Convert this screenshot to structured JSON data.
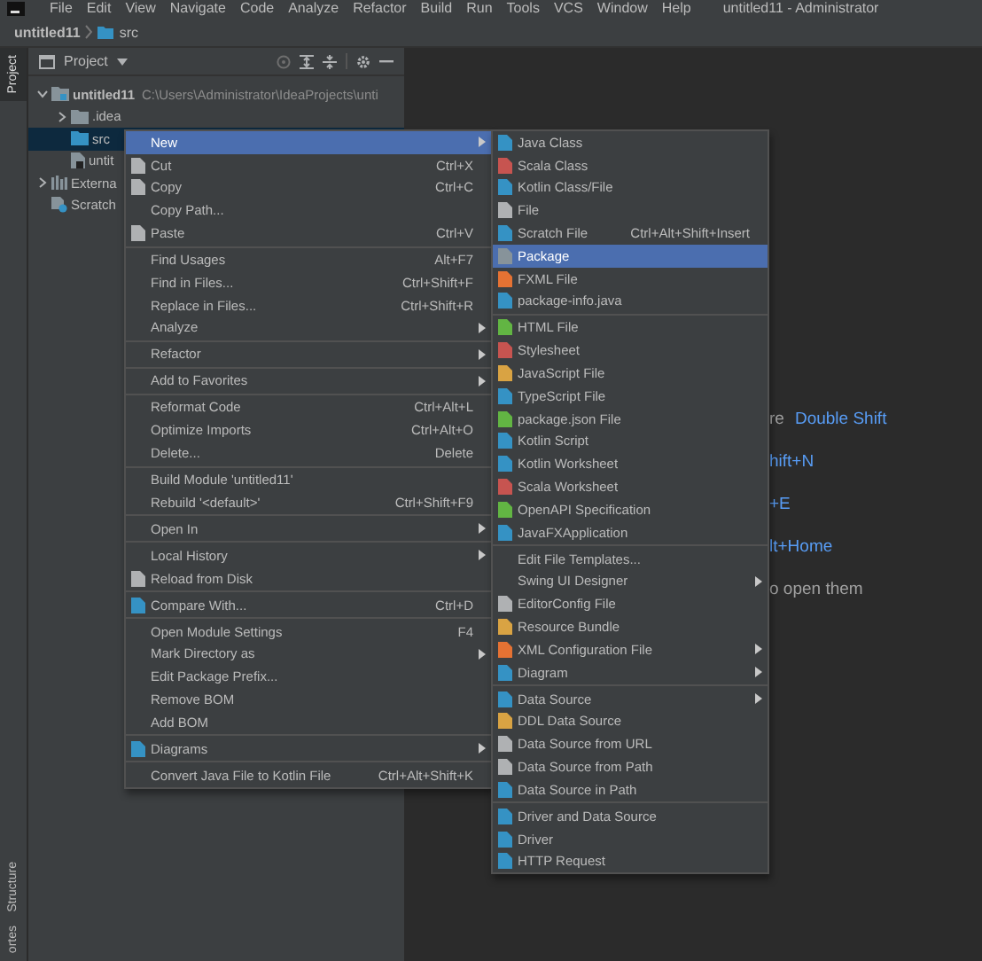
{
  "menubar": {
    "items": [
      "File",
      "Edit",
      "View",
      "Navigate",
      "Code",
      "Analyze",
      "Refactor",
      "Build",
      "Run",
      "Tools",
      "VCS",
      "Window",
      "Help"
    ],
    "title": "untitled11 - Administrator"
  },
  "breadcrumb": [
    "untitled11",
    "src"
  ],
  "tool_strip": [
    {
      "label": "Project",
      "selected": true
    },
    {
      "label": "Structure",
      "selected": false
    },
    {
      "label": "ortes",
      "selected": false
    }
  ],
  "project_panel": {
    "title": "Project",
    "tree": [
      {
        "kind": "module",
        "label": "untitled11",
        "path": "C:\\Users\\Administrator\\IdeaProjects\\unti",
        "expanded": true,
        "selected": false,
        "children": [
          {
            "kind": "folder",
            "label": ".idea",
            "expanded": false,
            "selected": false
          },
          {
            "kind": "source-folder",
            "label": "src",
            "selected": true
          },
          {
            "kind": "file",
            "label": "untit",
            "selected": false
          }
        ]
      },
      {
        "kind": "libraries",
        "label": "Externa",
        "expanded": false,
        "selected": false
      },
      {
        "kind": "scratches",
        "label": "Scratch",
        "selected": false
      }
    ]
  },
  "editor_hints": [
    {
      "text": "re",
      "shortcut": "Double Shift"
    },
    {
      "shortcut": "hift+N"
    },
    {
      "shortcut": "+E"
    },
    {
      "shortcut": "lt+Home"
    },
    {
      "text": "o open them"
    }
  ],
  "context_menu": [
    [
      {
        "label": "New",
        "submenu": true,
        "selected": true
      },
      {
        "label": "Cut",
        "shortcut": "Ctrl+X",
        "color": "#afb1b3",
        "selected": false
      },
      {
        "label": "Copy",
        "shortcut": "Ctrl+C",
        "color": "#afb1b3",
        "selected": false
      },
      {
        "label": "Copy Path...",
        "selected": false
      },
      {
        "label": "Paste",
        "shortcut": "Ctrl+V",
        "color": "#afb1b3",
        "selected": false
      }
    ],
    [
      {
        "label": "Find Usages",
        "shortcut": "Alt+F7",
        "selected": false
      },
      {
        "label": "Find in Files...",
        "shortcut": "Ctrl+Shift+F",
        "selected": false
      },
      {
        "label": "Replace in Files...",
        "shortcut": "Ctrl+Shift+R",
        "selected": false
      },
      {
        "label": "Analyze",
        "submenu": true,
        "selected": false
      }
    ],
    [
      {
        "label": "Refactor",
        "submenu": true,
        "selected": false
      }
    ],
    [
      {
        "label": "Add to Favorites",
        "submenu": true,
        "selected": false
      }
    ],
    [
      {
        "label": "Reformat Code",
        "shortcut": "Ctrl+Alt+L",
        "selected": false
      },
      {
        "label": "Optimize Imports",
        "shortcut": "Ctrl+Alt+O",
        "selected": false
      },
      {
        "label": "Delete...",
        "shortcut": "Delete",
        "selected": false
      }
    ],
    [
      {
        "label": "Build Module 'untitled11'",
        "selected": false
      },
      {
        "label": "Rebuild '<default>'",
        "shortcut": "Ctrl+Shift+F9",
        "selected": false
      }
    ],
    [
      {
        "label": "Open In",
        "submenu": true,
        "selected": false
      }
    ],
    [
      {
        "label": "Local History",
        "submenu": true,
        "selected": false
      },
      {
        "label": "Reload from Disk",
        "color": "#afb1b3",
        "selected": false
      }
    ],
    [
      {
        "label": "Compare With...",
        "shortcut": "Ctrl+D",
        "color": "#3592c4",
        "selected": false
      }
    ],
    [
      {
        "label": "Open Module Settings",
        "shortcut": "F4",
        "selected": false
      },
      {
        "label": "Mark Directory as",
        "submenu": true,
        "selected": false
      },
      {
        "label": "Edit Package Prefix...",
        "selected": false
      },
      {
        "label": "Remove BOM",
        "selected": false
      },
      {
        "label": "Add BOM",
        "selected": false
      }
    ],
    [
      {
        "label": "Diagrams",
        "submenu": true,
        "color": "#3592c4",
        "selected": false
      }
    ],
    [
      {
        "label": "Convert Java File to Kotlin File",
        "shortcut": "Ctrl+Alt+Shift+K",
        "selected": false
      }
    ]
  ],
  "new_submenu": [
    [
      {
        "label": "Java Class",
        "color": "#3592c4",
        "selected": false
      },
      {
        "label": "Scala Class",
        "color": "#c75450",
        "selected": false
      },
      {
        "label": "Kotlin Class/File",
        "color": "#3592c4",
        "selected": false
      },
      {
        "label": "File",
        "color": "#afb1b3",
        "selected": false
      },
      {
        "label": "Scratch File",
        "shortcut": "Ctrl+Alt+Shift+Insert",
        "color": "#3592c4",
        "selected": false
      },
      {
        "label": "Package",
        "color": "#87939a",
        "selected": true
      },
      {
        "label": "FXML File",
        "color": "#e57233",
        "selected": false
      },
      {
        "label": "package-info.java",
        "color": "#3592c4",
        "selected": false
      }
    ],
    [
      {
        "label": "HTML File",
        "color": "#62b543",
        "selected": false
      },
      {
        "label": "Stylesheet",
        "color": "#c75450",
        "selected": false
      },
      {
        "label": "JavaScript File",
        "color": "#d9a343",
        "selected": false
      },
      {
        "label": "TypeScript File",
        "color": "#3592c4",
        "selected": false
      },
      {
        "label": "package.json File",
        "color": "#62b543",
        "selected": false
      },
      {
        "label": "Kotlin Script",
        "color": "#3592c4",
        "selected": false
      },
      {
        "label": "Kotlin Worksheet",
        "color": "#3592c4",
        "selected": false
      },
      {
        "label": "Scala Worksheet",
        "color": "#c75450",
        "selected": false
      },
      {
        "label": "OpenAPI Specification",
        "color": "#62b543",
        "selected": false
      },
      {
        "label": "JavaFXApplication",
        "color": "#3592c4",
        "selected": false
      }
    ],
    [
      {
        "label": "Edit File Templates...",
        "selected": false
      },
      {
        "label": "Swing UI Designer",
        "submenu": true,
        "selected": false
      },
      {
        "label": "EditorConfig File",
        "color": "#afb1b3",
        "selected": false
      },
      {
        "label": "Resource Bundle",
        "color": "#d9a343",
        "selected": false
      },
      {
        "label": "XML Configuration File",
        "submenu": true,
        "color": "#e57233",
        "selected": false
      },
      {
        "label": "Diagram",
        "submenu": true,
        "color": "#3592c4",
        "selected": false
      }
    ],
    [
      {
        "label": "Data Source",
        "submenu": true,
        "color": "#3592c4",
        "selected": false
      },
      {
        "label": "DDL Data Source",
        "color": "#d9a343",
        "selected": false
      },
      {
        "label": "Data Source from URL",
        "color": "#afb1b3",
        "selected": false
      },
      {
        "label": "Data Source from Path",
        "color": "#afb1b3",
        "selected": false
      },
      {
        "label": "Data Source in Path",
        "color": "#3592c4",
        "selected": false
      }
    ],
    [
      {
        "label": "Driver and Data Source",
        "color": "#3592c4",
        "selected": false
      },
      {
        "label": "Driver",
        "color": "#3592c4",
        "selected": false
      },
      {
        "label": "HTTP Request",
        "color": "#3592c4",
        "selected": false
      }
    ]
  ]
}
